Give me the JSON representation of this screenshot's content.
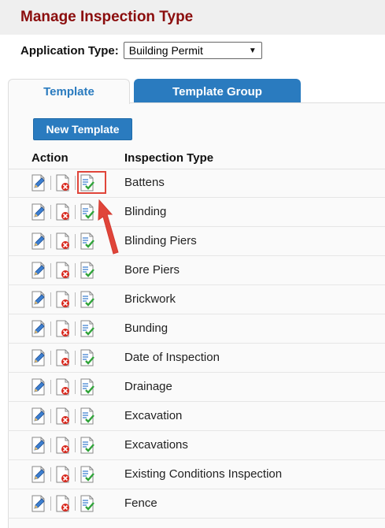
{
  "page": {
    "title": "Manage Inspection Type"
  },
  "filter": {
    "label": "Application Type:",
    "selected": "Building Permit"
  },
  "tabs": [
    {
      "label": "Template",
      "active": true
    },
    {
      "label": "Template Group",
      "active": false
    }
  ],
  "toolbar": {
    "new_template_label": "New Template"
  },
  "table": {
    "headers": {
      "action": "Action",
      "type": "Inspection Type"
    },
    "rows": [
      {
        "name": "Battens"
      },
      {
        "name": "Blinding"
      },
      {
        "name": "Blinding Piers"
      },
      {
        "name": "Bore Piers"
      },
      {
        "name": "Brickwork"
      },
      {
        "name": "Bunding"
      },
      {
        "name": "Date of Inspection"
      },
      {
        "name": "Drainage"
      },
      {
        "name": "Excavation"
      },
      {
        "name": "Excavations"
      },
      {
        "name": "Existing Conditions Inspection"
      },
      {
        "name": "Fence"
      }
    ]
  },
  "icons": {
    "edit": "edit-icon",
    "delete": "delete-icon",
    "checklist": "checklist-icon"
  },
  "colors": {
    "title": "#8b0d0d",
    "accent": "#2a7bbf",
    "callout": "#e0453a"
  }
}
